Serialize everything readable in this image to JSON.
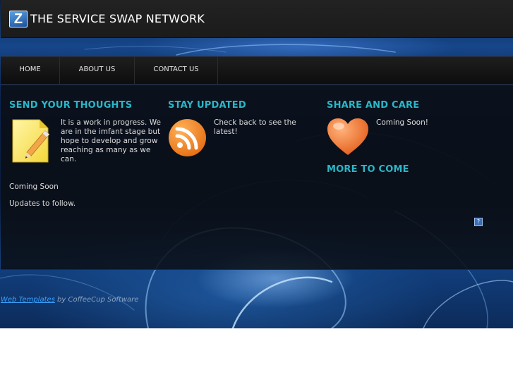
{
  "header": {
    "logo_glyph": "Z",
    "site_title": "THE SERVICE SWAP NETWORK"
  },
  "nav": {
    "items": [
      {
        "label": "HOME"
      },
      {
        "label": "ABOUT US"
      },
      {
        "label": "CONTACT US"
      }
    ]
  },
  "columns": {
    "thoughts": {
      "heading": "SEND YOUR THOUGHTS",
      "icon": "notepad-pencil-icon",
      "body_lines": [
        "It is a work in progress. We",
        "are in the imfant stage but",
        "hope to develop and grow",
        "reaching as many as we",
        "can."
      ],
      "coming_soon": "Coming Soon",
      "updates": "Updates to follow."
    },
    "updated": {
      "heading": "STAY UPDATED",
      "icon": "rss-feed-icon",
      "body_lines": [
        "Check back to see the",
        "latest!"
      ]
    },
    "share": {
      "heading": "SHARE AND CARE",
      "icon": "heart-icon",
      "body": "Coming Soon!",
      "more_heading": "MORE TO COME"
    }
  },
  "help_glyph": "?",
  "footer": {
    "link_text": "Web Templates",
    "suffix": " by CoffeeCup Software"
  },
  "colors": {
    "heading_accent": "#2ab7c8",
    "link": "#3aa3ff",
    "rss_orange": "#f07a1a",
    "heart_orange": "#f26a1b"
  }
}
